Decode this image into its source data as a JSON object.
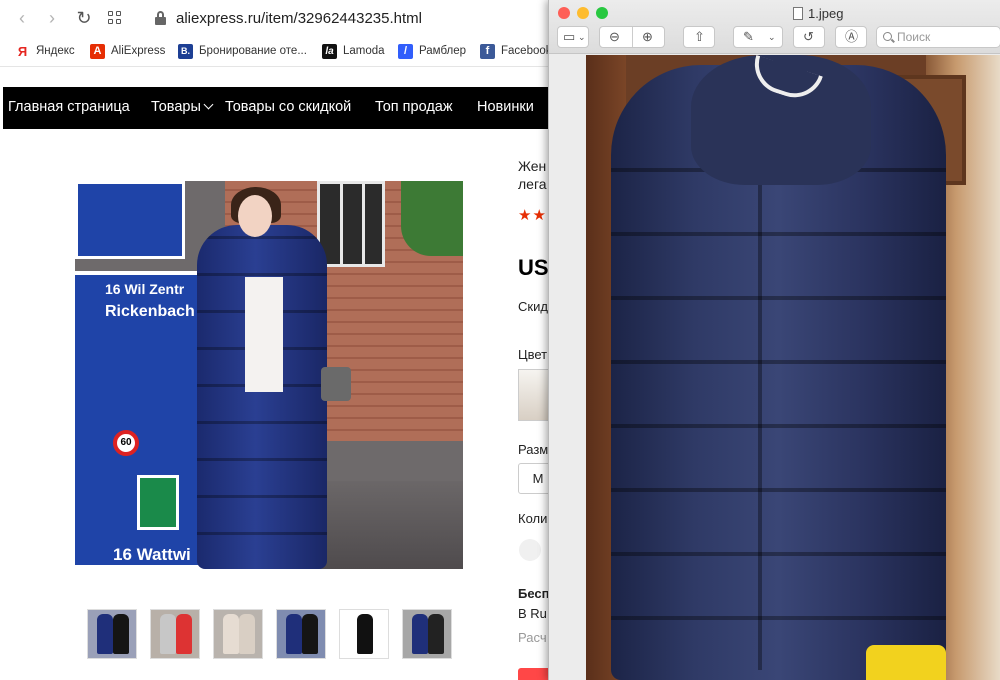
{
  "browser": {
    "url": "aliexpress.ru/item/32962443235.html",
    "bookmarks": [
      {
        "label": "Яндекс",
        "icon": "yandex-icon",
        "color": "#e52620",
        "glyph": "Я"
      },
      {
        "label": "AliExpress",
        "icon": "aliexpress-icon",
        "color": "#e62e04",
        "glyph": "A"
      },
      {
        "label": "Бронирование оте...",
        "icon": "booking-icon",
        "color": "#1d3f94",
        "glyph": "B."
      },
      {
        "label": "Lamoda",
        "icon": "lamoda-icon",
        "color": "#111111",
        "glyph": "la"
      },
      {
        "label": "Рамблер",
        "icon": "rambler-icon",
        "color": "#315efb",
        "glyph": "/"
      },
      {
        "label": "Facebook",
        "icon": "facebook-icon",
        "color": "#3b5998",
        "glyph": "f"
      }
    ]
  },
  "site_nav": {
    "items": [
      "Главная страница",
      "Товары",
      "Товары со скидкой",
      "Топ продаж",
      "Новинки"
    ]
  },
  "product": {
    "title_line1": "Жен",
    "title_line2": "лега",
    "stars": "★★",
    "price": "US",
    "discount_label": "Скид",
    "color_label": "Цвет",
    "size_label": "Разме",
    "selected_size": "M",
    "qty_label": "Колич",
    "shipping_title": "Бесп",
    "shipping_line": "В Ru",
    "calc_label": "Расч",
    "accent": "#e62e04",
    "thumbnails": [
      {
        "coat": "#1f2f7a",
        "coat2": "#151515",
        "bg": "#9aa0b8"
      },
      {
        "coat": "#c7c7c7",
        "coat2": "#d33",
        "bg": "#b8b0a8"
      },
      {
        "coat": "#e6dcd2",
        "coat2": "#d9cfc4",
        "bg": "#b9b3ad"
      },
      {
        "coat": "#1f2f7a",
        "coat2": "#151515",
        "bg": "#7f8cb0"
      },
      {
        "coat": "#111111",
        "coat2": "#111111",
        "bg": "#ffffff"
      },
      {
        "coat": "#1f2f7a",
        "coat2": "#222222",
        "bg": "#a7a7a7"
      }
    ]
  },
  "sign": {
    "line1": "16 Wil Zentr",
    "line2": "Rickenbach",
    "speed": "60",
    "line3": "16 Wattwi"
  },
  "preview": {
    "filename": "1.jpeg",
    "search_placeholder": "Поиск",
    "traffic_lights": [
      "#fe5f57",
      "#febc2e",
      "#28c840"
    ]
  }
}
